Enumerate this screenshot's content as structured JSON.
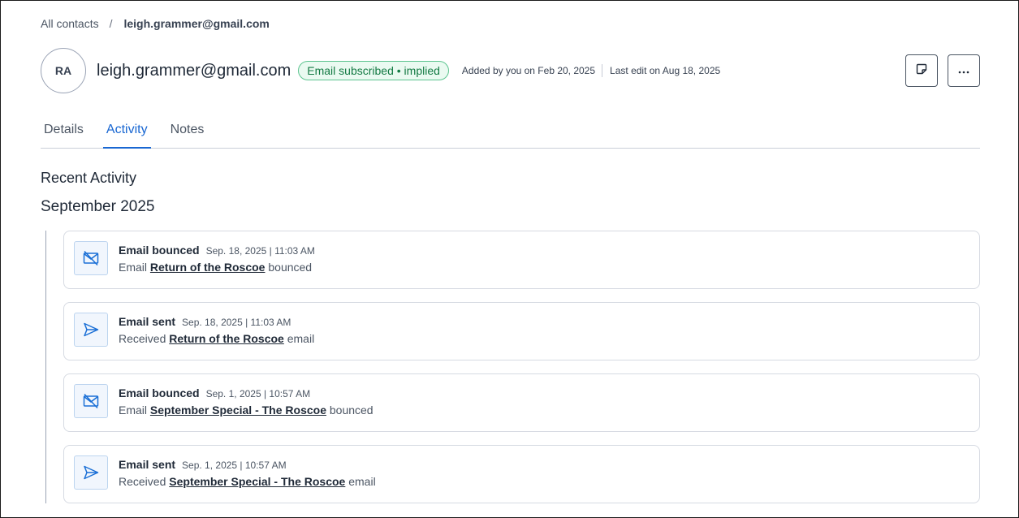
{
  "breadcrumb": {
    "root": "All contacts",
    "separator": "/",
    "current": "leigh.grammer@gmail.com"
  },
  "contact": {
    "initials": "RA",
    "email": "leigh.grammer@gmail.com",
    "subscription_badge": "Email subscribed • implied",
    "added_by": "Added by you on Feb 20, 2025",
    "last_edit": "Last edit on Aug 18, 2025"
  },
  "header_buttons": {
    "note_icon": "sticky-note-icon",
    "more_icon": "more-horizontal-icon"
  },
  "tabs": [
    {
      "label": "Details",
      "active": false
    },
    {
      "label": "Activity",
      "active": true
    },
    {
      "label": "Notes",
      "active": false
    }
  ],
  "activity": {
    "section_title": "Recent Activity",
    "month": "September 2025",
    "items": [
      {
        "type": "bounced",
        "icon": "mail-slash-icon",
        "title": "Email bounced",
        "time": "Sep. 18, 2025 | 11:03 AM",
        "prefix": "Email",
        "campaign": "Return of the Roscoe",
        "suffix": "bounced"
      },
      {
        "type": "sent",
        "icon": "send-icon",
        "title": "Email sent",
        "time": "Sep. 18, 2025 | 11:03 AM",
        "prefix": "Received",
        "campaign": "Return of the Roscoe",
        "suffix": "email"
      },
      {
        "type": "bounced",
        "icon": "mail-slash-icon",
        "title": "Email bounced",
        "time": "Sep. 1, 2025 | 10:57 AM",
        "prefix": "Email",
        "campaign": "September Special - The Roscoe",
        "suffix": "bounced"
      },
      {
        "type": "sent",
        "icon": "send-icon",
        "title": "Email sent",
        "time": "Sep. 1, 2025 | 10:57 AM",
        "prefix": "Received",
        "campaign": "September Special - The Roscoe",
        "suffix": "email"
      }
    ]
  },
  "colors": {
    "accent": "#1967d2",
    "badge_green": "#137a43",
    "icon_blue": "#1a6fd6"
  }
}
